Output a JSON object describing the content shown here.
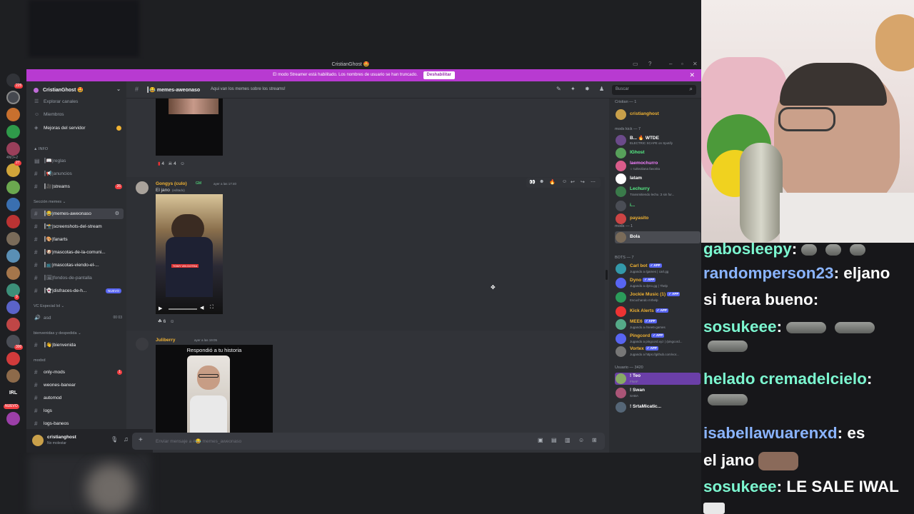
{
  "window": {
    "title": "CristianGhost 🤩"
  },
  "banner": {
    "text": "El modo Streamer está habilitado. Los nombres de usuario se han truncado.",
    "button": "Deshabilitar"
  },
  "server": {
    "name": "CristianGhost 🤩",
    "browse": "Explorar canales",
    "members": "Miembros",
    "boosts": "Mejoras del servidor"
  },
  "guild_badges": [
    "225",
    "27",
    "4NO+2",
    "9",
    "300",
    "NUEVO"
  ],
  "categories": {
    "info": "INFO",
    "memes": "Sección memes",
    "vc": "VC Especial lol",
    "welcome": "bienvenidas y despedida",
    "mod": "modxd"
  },
  "channels": [
    {
      "name": "reglas"
    },
    {
      "name": "anuncios"
    },
    {
      "name": "streams",
      "count": "26"
    },
    {
      "name": "memes-aweonaso"
    },
    {
      "name": "screenshots-del-stream"
    },
    {
      "name": "fanarts"
    },
    {
      "name": "mascotas-de-la-comuni..."
    },
    {
      "name": "mascotas-viendo-el-..."
    },
    {
      "name": "fondos-de-pantalla"
    },
    {
      "name": "disfraces-de-h...",
      "tag": "NUEVO"
    },
    {
      "name": "asd",
      "count": "00 03"
    },
    {
      "name": "bienvenida"
    },
    {
      "name": "only-mods",
      "count": "1"
    },
    {
      "name": "weones-banear"
    },
    {
      "name": "automod"
    },
    {
      "name": "logs"
    },
    {
      "name": "logs-baneos"
    }
  ],
  "user": {
    "name": "cristianghost",
    "status": "No molestar"
  },
  "header": {
    "channel": "memes-aweonaso",
    "topic": "Aqui van los memes sobre los streams!",
    "search": "Buscar"
  },
  "messages": [
    {
      "reactions": [
        "4",
        "4"
      ]
    },
    {
      "author": "Gongys (culo)",
      "tag": "GM",
      "time": "ayer a las 17:40",
      "text": "El jano",
      "edited": "(editado)",
      "video_caption": "TOMY VIN DOTEA",
      "reactions": [
        "6"
      ]
    },
    {
      "author": "Juliberry",
      "time": "ayer a las 19:05",
      "reply_label": "Respondió a tu historia"
    }
  ],
  "composer": {
    "placeholder": "Enviar mensaje a #😂 memes_aweonaso"
  },
  "members": {
    "groups": [
      {
        "title": "Cristian — 1",
        "items": [
          {
            "name": "cristianghost",
            "color": "#f0b232"
          }
        ]
      },
      {
        "title": "mods kick — 7",
        "items": [
          {
            "name": "B... 🔥 WTDE",
            "status": "ELECTRIC SCAPE on Spotify",
            "color": "#ffffff"
          },
          {
            "name": "IGhost",
            "color": "#57f287"
          },
          {
            "name": "laemochurro",
            "status": "☆ tu/teoliana favorita",
            "color": "#f47fff"
          },
          {
            "name": "latam",
            "color": "#ffffff"
          },
          {
            "name": "Lechurry",
            "status": "Transmitiendo lechu :3 sin fur...",
            "color": "#57f287"
          },
          {
            "name": "i...",
            "color": "#57f287"
          },
          {
            "name": "payasito",
            "color": "#f0b232"
          }
        ]
      },
      {
        "title": "mods — 1",
        "items": [
          {
            "name": "Bola",
            "color": "#ffffff"
          }
        ]
      },
      {
        "title": "BOTS — 7",
        "items": [
          {
            "name": "Carl bot",
            "status": "Jugando a /games | carl.gg",
            "color": "#f0b232",
            "tag": "APP"
          },
          {
            "name": "Dyno",
            "status": "Jugando a dyno.gg | ?help",
            "color": "#f0b232",
            "tag": "APP"
          },
          {
            "name": "Jockie Music (1)",
            "status": "Escuchando m!help",
            "color": "#f0b232",
            "tag": "APP"
          },
          {
            "name": "Kick Alerts",
            "color": "#f0b232",
            "tag": "APP"
          },
          {
            "name": "MEE6",
            "status": "Jugando a /mee6-games",
            "color": "#f0b232",
            "tag": "APP"
          },
          {
            "name": "Pingcord",
            "status": "Jugando a pingcord.xyz | /pingcord...",
            "color": "#f0b232",
            "tag": "APP"
          },
          {
            "name": "Vortex",
            "status": "Jugando a https://github.com/vor...",
            "color": "#f0b232",
            "tag": "APP"
          }
        ]
      },
      {
        "title": "Usuario — 3420",
        "items": [
          {
            "name": "! Teo",
            "status": "FNAF",
            "color": "#ffffff"
          },
          {
            "name": "! Swan",
            "status": "SABA",
            "color": "#ffffff"
          },
          {
            "name": "! SrtaMicatic...",
            "color": "#ffffff"
          }
        ]
      }
    ]
  },
  "stream_chat": [
    {
      "user": "gabosleepy",
      "text": ":"
    },
    {
      "user": "randomperson23",
      "text": ": eljano"
    },
    {
      "user": "",
      "text": "si fuera bueno:"
    },
    {
      "user": "sosukeee",
      "text": ":"
    },
    {
      "user": "helado cremadelcielo",
      "text": ":"
    },
    {
      "user": "isabellawuarenxd",
      "text": ": es"
    },
    {
      "user": "",
      "text": "el jano"
    },
    {
      "user": "sosukeee",
      "text": ": LE SALE IWAL"
    }
  ]
}
